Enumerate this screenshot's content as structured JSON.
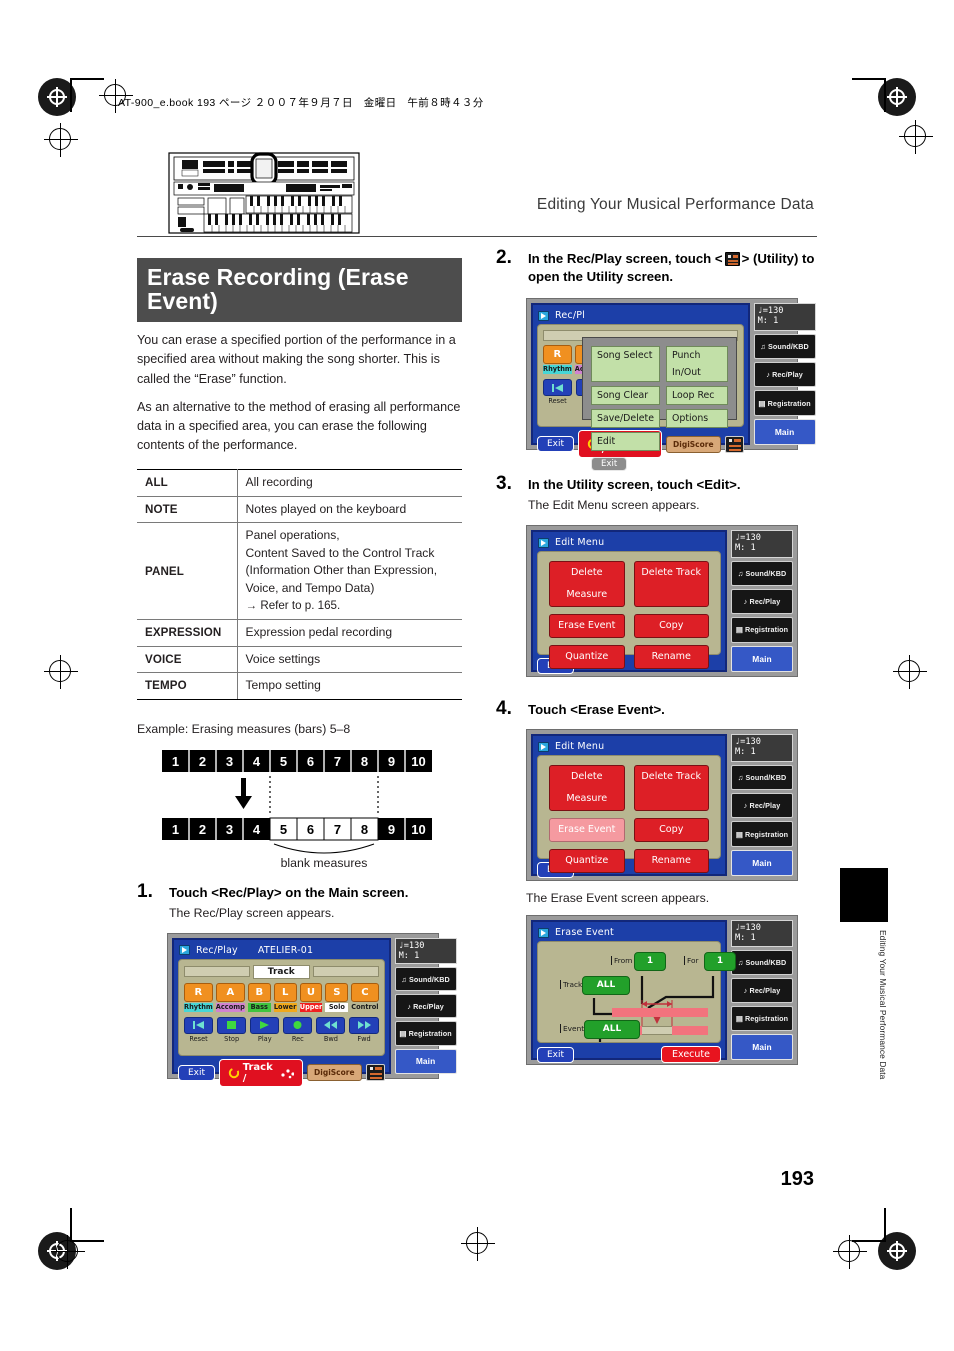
{
  "page": {
    "filestamp": "AT-900_e.book  193 ページ  ２００７年９月７日　金曜日　午前８時４３分",
    "running_head": "Editing Your Musical Performance Data",
    "page_number": "193",
    "margin_tab_text": "Editing Your Musical Performance Data"
  },
  "section": {
    "title": "Erase Recording (Erase Event)",
    "intro_1": "You can erase a specified portion of the performance in a specified area without making the song shorter. This is called the “Erase” function.",
    "intro_2": "As an alternative to the method of erasing all performance data in a specified area, you can erase the following contents of the performance."
  },
  "spec_table": {
    "rows": [
      {
        "key": "ALL",
        "value": "All recording"
      },
      {
        "key": "NOTE",
        "value": "Notes played on the keyboard"
      },
      {
        "key": "PANEL",
        "value": "Panel operations,\nContent Saved to the Control Track\n(Information Other than Expression,\nVoice, and Tempo Data)",
        "ref": "→ Refer to p. 165."
      },
      {
        "key": "EXPRESSION",
        "value": "Expression pedal recording"
      },
      {
        "key": "VOICE",
        "value": "Voice settings"
      },
      {
        "key": "TEMPO",
        "value": "Tempo setting"
      }
    ]
  },
  "figure": {
    "example_label": "Example: Erasing measures (bars) 5–8",
    "measures_before": [
      "1",
      "2",
      "3",
      "4",
      "5",
      "6",
      "7",
      "8",
      "9",
      "10"
    ],
    "measures_after": [
      "1",
      "2",
      "3",
      "4",
      "5",
      "6",
      "7",
      "8",
      "9",
      "10"
    ],
    "blank_from": 5,
    "blank_to": 8,
    "blank_caption": "blank measures"
  },
  "steps": {
    "s1": {
      "num": "1.",
      "head": "Touch <Rec/Play> on the Main screen.",
      "sub": "The Rec/Play screen appears."
    },
    "s2": {
      "num": "2.",
      "head_a": "In the Rec/Play screen, touch <",
      "head_b": "> (Utility) to open the Utility screen.",
      "icon": "utility-icon"
    },
    "s3": {
      "num": "3.",
      "head": "In the Utility screen, touch <Edit>.",
      "sub": "The Edit Menu screen appears."
    },
    "s4": {
      "num": "4.",
      "head": "Touch <Erase Event>.",
      "sub": "The Erase Event screen appears."
    }
  },
  "lcd_common": {
    "tempo_line1": "♩=130",
    "tempo_line2": "M:    1",
    "side_buttons": [
      {
        "label": "Sound/KBD",
        "icon": "note-icon"
      },
      {
        "label": "Rec/Play",
        "icon": "speaker-icon"
      },
      {
        "label": "Registration",
        "icon": "registration-icon"
      }
    ],
    "main_button": "Main"
  },
  "screen_recplay": {
    "title": "Rec/Play",
    "song_name": "ATELIER-01",
    "track_label": "Track",
    "tracks": [
      {
        "letter": "R",
        "name": "Rhythm",
        "color": "#46d6d6"
      },
      {
        "letter": "A",
        "name": "Accomp",
        "color": "#d083d0"
      },
      {
        "letter": "B",
        "name": "Bass",
        "color": "#3fc43f"
      },
      {
        "letter": "L",
        "name": "Lower",
        "color": "#f0a81c"
      },
      {
        "letter": "U",
        "name": "Upper",
        "color": "#f02020"
      },
      {
        "letter": "S",
        "name": "Solo",
        "color": "#ffffff"
      },
      {
        "letter": "C",
        "name": "Control",
        "color": "#b8b691"
      }
    ],
    "transport": [
      {
        "label": "Reset",
        "glyph": "reset-icon"
      },
      {
        "label": "Stop",
        "glyph": "stop-icon"
      },
      {
        "label": "Play",
        "glyph": "play-icon"
      },
      {
        "label": "Rec",
        "glyph": "record-icon"
      },
      {
        "label": "Bwd",
        "glyph": "rewind-icon"
      },
      {
        "label": "Fwd",
        "glyph": "fast-forward-icon"
      }
    ],
    "exit": "Exit",
    "track_button": "Track /",
    "digiscore": "DigiScore",
    "utility": "utility-icon"
  },
  "screen_utility": {
    "title": "Rec/Pl",
    "menu_items": [
      "Song Select",
      "Punch In/Out",
      "Song Clear",
      "Loop Rec",
      "Save/Delete",
      "Options",
      "Edit"
    ],
    "exit": "Exit"
  },
  "screen_editmenu": {
    "title": "Edit Menu",
    "buttons": [
      "Delete Measure",
      "Delete Track",
      "Erase Event",
      "Copy",
      "Quantize",
      "Rename"
    ],
    "selected": "",
    "exit": "Exit"
  },
  "screen_editmenu_selected": {
    "title": "Edit Menu",
    "buttons": [
      "Delete Measure",
      "Delete Track",
      "Erase Event",
      "Copy",
      "Quantize",
      "Rename"
    ],
    "selected": "Erase Event",
    "exit": "Exit"
  },
  "screen_eraseevent": {
    "title": "Erase Event",
    "label_from": "From",
    "value_from": "1",
    "label_for": "For",
    "value_for": "1",
    "label_track": "Track",
    "value_track": "ALL",
    "label_event": "Event",
    "value_event": "ALL",
    "exit": "Exit",
    "execute": "Execute"
  },
  "colors": {
    "title_bar_bg": "#4d4d4d",
    "lcd_frame": "#1c3fa8",
    "lcd_panel": "#b8b691",
    "track_orange": "#f09020",
    "edit_red": "#dd1f26",
    "edit_red_selected": "#f59aa0",
    "menu_green": "#c2e0a8",
    "value_green": "#22a02a",
    "main_blue": "#3558c6"
  }
}
